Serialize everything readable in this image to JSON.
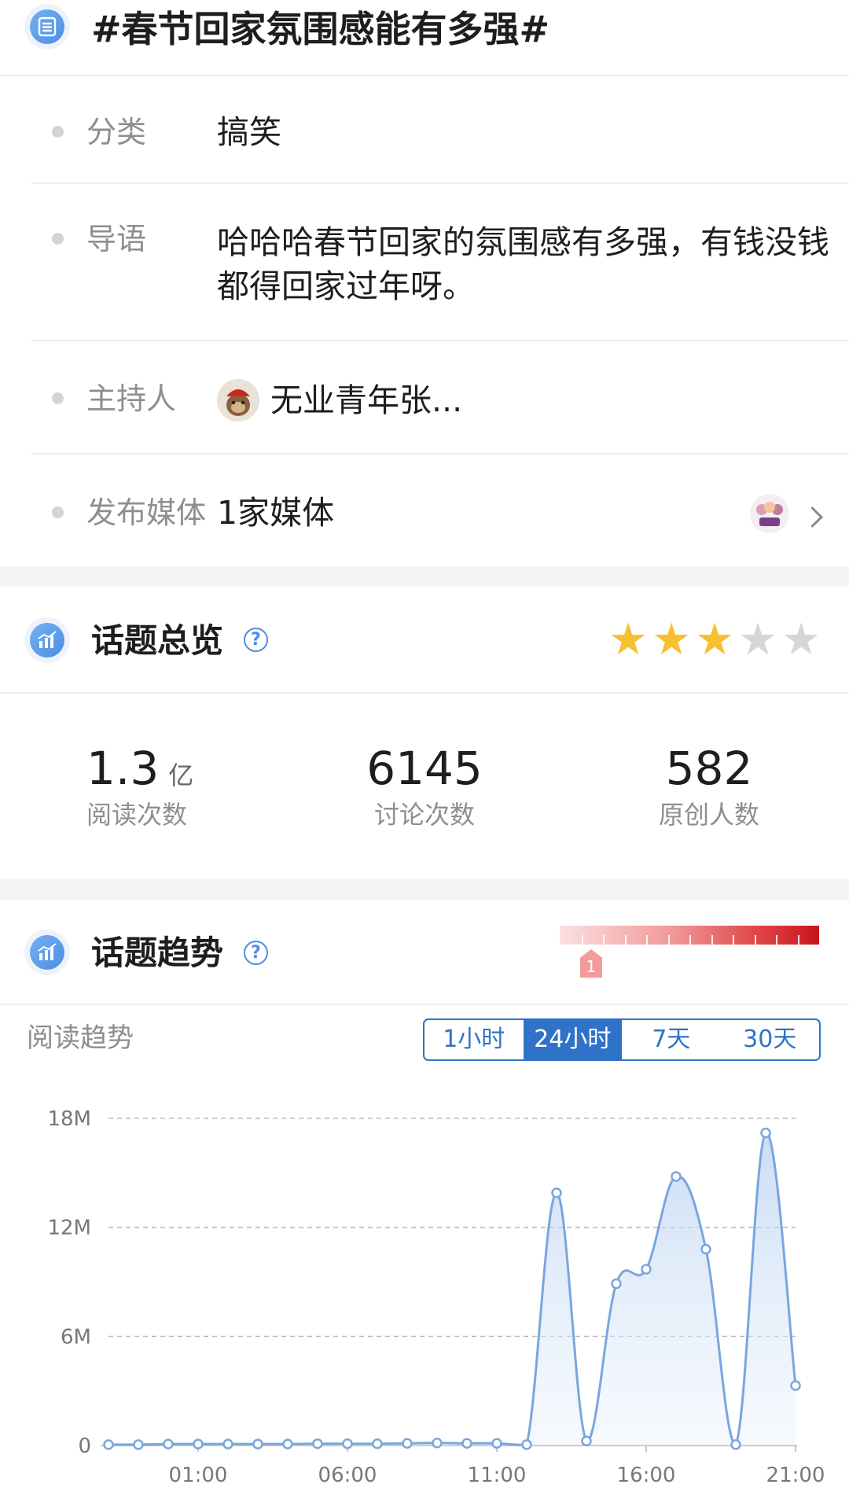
{
  "header": {
    "title": "#春节回家氛围感能有多强#",
    "icon": "list-icon"
  },
  "info": {
    "category": {
      "label": "分类",
      "value": "搞笑"
    },
    "intro": {
      "label": "导语",
      "value": "哈哈哈春节回家的氛围感有多强，有钱没钱都得回家过年呀。"
    },
    "host": {
      "label": "主持人",
      "value": "无业青年张..."
    },
    "media": {
      "label": "发布媒体",
      "value": "1家媒体"
    }
  },
  "overview": {
    "title": "话题总览",
    "help": "?",
    "rating": 3,
    "rating_max": 5,
    "star_filled_color": "#f6c131",
    "star_empty_color": "#d6d6d6",
    "stats": [
      {
        "value": "1.3",
        "unit": "亿",
        "label": "阅读次数"
      },
      {
        "value": "6145",
        "unit": "",
        "label": "讨论次数"
      },
      {
        "value": "582",
        "unit": "",
        "label": "原创人数"
      }
    ]
  },
  "trend": {
    "title": "话题趋势",
    "help": "?",
    "heat_marker": "1",
    "subtitle": "阅读趋势",
    "tabs": [
      "1小时",
      "24小时",
      "7天",
      "30天"
    ],
    "active_tab": "24小时",
    "accent_color": "#2f73c9",
    "line_color": "#7aa6de"
  },
  "chart_data": {
    "type": "area",
    "x": [
      "22:00",
      "23:00",
      "00:00",
      "01:00",
      "02:00",
      "03:00",
      "04:00",
      "05:00",
      "06:00",
      "07:00",
      "08:00",
      "09:00",
      "10:00",
      "11:00",
      "12:00",
      "13:00",
      "14:00",
      "15:00",
      "16:00",
      "17:00",
      "18:00",
      "19:00",
      "20:00",
      "21:00"
    ],
    "x_tick_labels": [
      "01:00",
      "06:00",
      "11:00",
      "16:00",
      "21:00"
    ],
    "values": [
      0.05,
      0.05,
      0.08,
      0.08,
      0.08,
      0.08,
      0.08,
      0.1,
      0.1,
      0.1,
      0.12,
      0.14,
      0.12,
      0.12,
      0.05,
      13.9,
      0.25,
      8.9,
      9.7,
      14.8,
      10.8,
      0.05,
      17.2,
      3.3
    ],
    "units": "M",
    "y_ticks": [
      "0",
      "6M",
      "12M",
      "18M"
    ],
    "ylim": [
      0,
      18
    ],
    "grid": true,
    "title": "",
    "xlabel": "",
    "ylabel": ""
  }
}
